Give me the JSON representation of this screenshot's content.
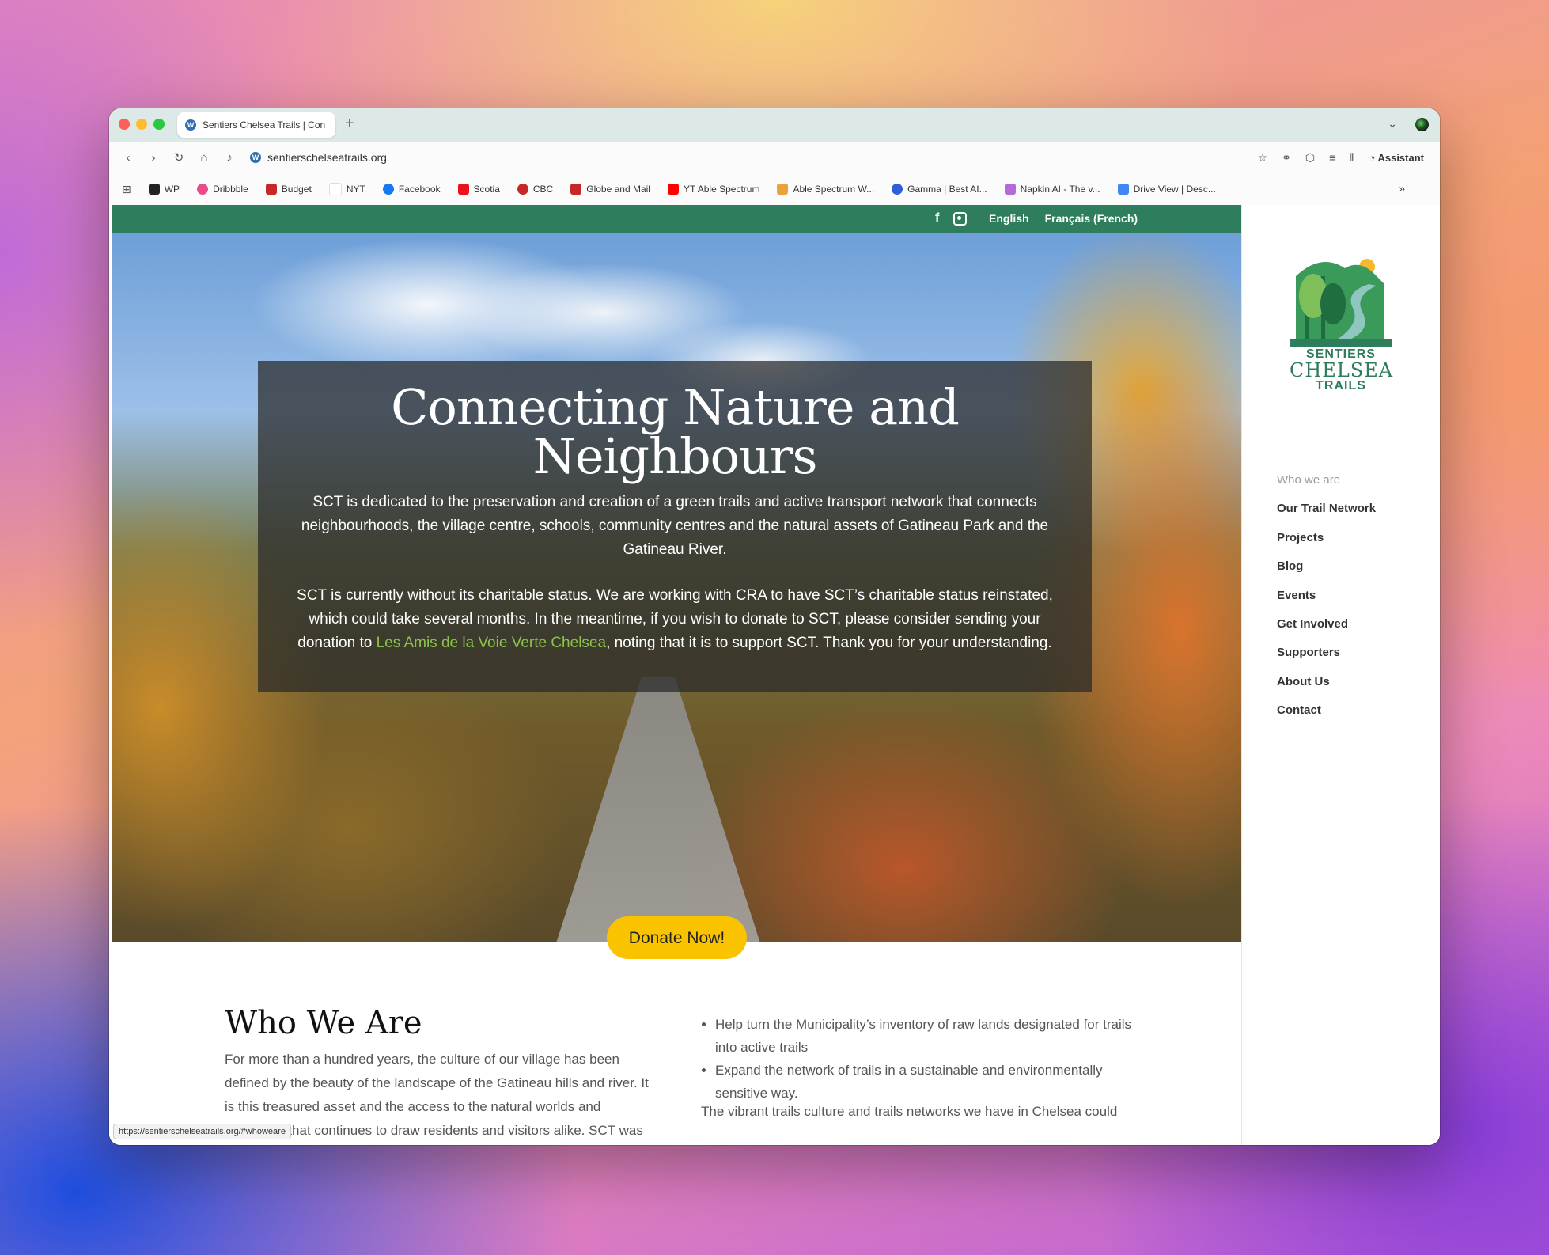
{
  "browser": {
    "tab_title": "Sentiers Chelsea Trails | Con",
    "new_tab": "+",
    "url": "sentierschelseatrails.org",
    "assistant_label": "Assistant",
    "status_url": "https://sentierschelseatrails.org/#whoweare",
    "bookmarks": [
      "WP",
      "Dribbble",
      "Budget",
      "NYT",
      "Facebook",
      "Scotia",
      "CBC",
      "Globe and Mail",
      "YT Able Spectrum",
      "Able Spectrum W...",
      "Gamma | Best AI...",
      "Napkin AI - The v...",
      "Drive View | Desc..."
    ],
    "bookmark_colors": [
      "#222222",
      "#ea4c89",
      "#c62828",
      "#ffffff",
      "#1877f2",
      "#ec111a",
      "#c62828",
      "#c62828",
      "#ff0000",
      "#e8a33c",
      "#2f5fd8",
      "#b46bd8",
      "#4285f4"
    ]
  },
  "topbar": {
    "languages": [
      "English",
      "Français (French)"
    ],
    "color": "#2e7d5c"
  },
  "hero": {
    "title": "Connecting Nature and Neighbours",
    "paragraph1": "SCT is dedicated to the preservation and creation of a green trails and active transport network that connects neighbourhoods, the village centre, schools, community centres and the natural assets of Gatineau Park and the Gatineau River.",
    "paragraph2_before": "SCT is currently without its charitable status. We are working with CRA to have SCT’s charitable status reinstated, which could take several months. In the meantime, if you wish to donate to SCT, please consider sending your donation to ",
    "paragraph2_link": "Les Amis de la Voie Verte Chelsea",
    "paragraph2_after": ", noting that it is to support SCT. Thank you for your understanding.",
    "donate_label": "Donate Now!"
  },
  "logo": {
    "line1": "SENTIERS",
    "line2": "CHELSEA",
    "line3": "TRAILS"
  },
  "sidebar": {
    "items": [
      "Who we are",
      "Our Trail Network",
      "Projects",
      "Blog",
      "Events",
      "Get Involved",
      "Supporters",
      "About Us",
      "Contact"
    ]
  },
  "who": {
    "title": "Who We Are",
    "paragraph": "For more than a hundred years, the culture of our village has been defined by the beauty of the landscape of the Gatineau hills and river. It is this treasured asset and the access to the natural worlds and recreation that continues to draw residents and visitors alike. SCT was",
    "list": [
      "Help turn the Municipality’s inventory of raw lands designated for trails into active trails",
      "Expand the network of trails in a sustainable and environmentally sensitive way."
    ],
    "paragraph2": "The vibrant trails culture and trails networks we have in Chelsea could"
  }
}
